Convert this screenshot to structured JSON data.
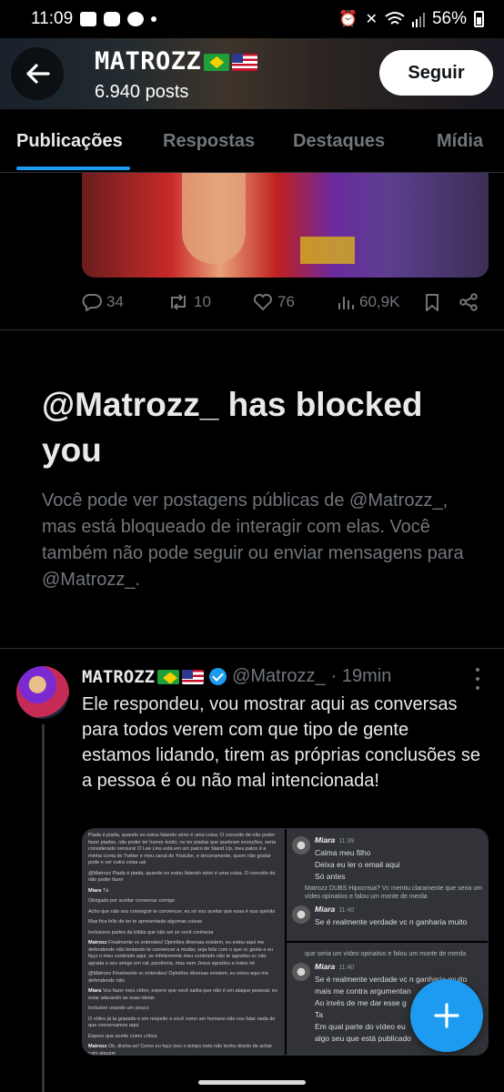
{
  "status_bar": {
    "time": "11:09",
    "battery": "56%"
  },
  "profile_header": {
    "name": "MATROZZ",
    "post_count": "6.940 posts",
    "follow_label": "Seguir"
  },
  "tabs": [
    {
      "label": "Publicações",
      "active": true
    },
    {
      "label": "Respostas",
      "active": false
    },
    {
      "label": "Destaques",
      "active": false
    },
    {
      "label": "Mídia",
      "active": false
    }
  ],
  "previous_post": {
    "replies": "34",
    "reposts": "10",
    "likes": "76",
    "views": "60,9K"
  },
  "blocked_notice": {
    "title": "@Matrozz_ has blocked you",
    "body": "Você pode ver postagens públicas de @Matrozz_, mas está bloqueado de interagir com elas. Você também não pode seguir ou enviar mensagens para @Matrozz_."
  },
  "tweet": {
    "name": "MATROZZ",
    "handle": "@Matrozz_",
    "time": "· 19min",
    "text": "Ele respondeu, vou mostrar aqui as conversas para todos verem com que tipo de gente estamos lidando, tirem as próprias conclusões se a pessoa é ou não mal intencionada!",
    "media_left": [
      {
        "text": "Piada é piada, quando eu estou falando sério é uma coisa. O conceito de não poder fazer piadas, não poder ter humor ácido, ou ter piadas que quebram exceções, seria considerado censura! O Lee Lins está em um palco de Stand Up, meu palco é a minha conta do Twitter e meu canal do Youtube, e sinceramente, quem não gostar pode e ver outra coisa uai"
      },
      {
        "text": "@Matrozz Piada é piada, quando eu estou falando sério é uma coisa. O conceito de não poder fazer"
      },
      {
        "name": "Miara",
        "text": "Tá"
      },
      {
        "text": "Obrigado por aceitar conversar comigo"
      },
      {
        "text": "Acho que não vou conseguir te convencer, eu só vou aceitar que essa é sua opinião"
      },
      {
        "text": "Mas fica feliz de ter te apresentado algumas coisas"
      },
      {
        "text": "Inclusives partes da bíblia que não sei se você conhecia"
      },
      {
        "name": "Matrozz",
        "text": "Finalmente vc entendeu! Opiniões diversas existem, eu estou aqui me defendendo não tentando te convencer a mudar, seja feliz com o que vc gosta e eu faço o meu conteúdo aqui, se infelizmente meu conteúdo não te agradou vc não agrada o seu amigo em cal, paciência, mas nem Jesus agradou a todos né"
      },
      {
        "text": "@Matrozz Finalmente vc entendeu! Opiniões diversas existem, eu estou aqui me defendendo não"
      },
      {
        "name": "Miara",
        "text": "Vou fazer meu vídeo, espero que você saiba que não é um ataque pessoal, eu estar atacando as suas ideias"
      },
      {
        "text": "Inclusive usando um pouco"
      },
      {
        "text": "O vídeo já ta gravado e em respeito a você como ser humano não vou falar nada do que conversamos aqui"
      },
      {
        "text": "Espero que aceite como crítica"
      },
      {
        "name": "Matrozz",
        "text": "Ok, divirta-se! Como eu faço isso o tempo todo não tenho direito de achar ruim alguém"
      }
    ],
    "media_right_top": [
      {
        "name": "Miara",
        "time": "11:39",
        "lines": [
          "Calma meu filho",
          "Deixa eu ler o email aqui",
          "Só antes"
        ]
      },
      {
        "ref": "Matrozz DUBS Hipocrisia? Vc mentiu claramente que seria um vídeo opinativo e falou um monte de merda"
      },
      {
        "name": "Miara",
        "time": "11:40",
        "lines": [
          "Se é realmente verdade vc n ganharia muito"
        ]
      }
    ],
    "media_right_bottom": [
      {
        "ref": "que seria um vídeo opinativo e falou um monte de merda"
      },
      {
        "name": "Miara",
        "time": "11:40",
        "lines": [
          "Se é realmente verdade vc n ganharia muito mais me contra argumentan",
          "Ao invés de me dar esse g",
          "Ta",
          "Em qual parte do vídeo eu",
          "algo seu que está publicado"
        ]
      }
    ]
  },
  "colors": {
    "accent": "#1d9bf0",
    "muted": "#71767b",
    "border": "#2f3336",
    "background": "#000000"
  }
}
